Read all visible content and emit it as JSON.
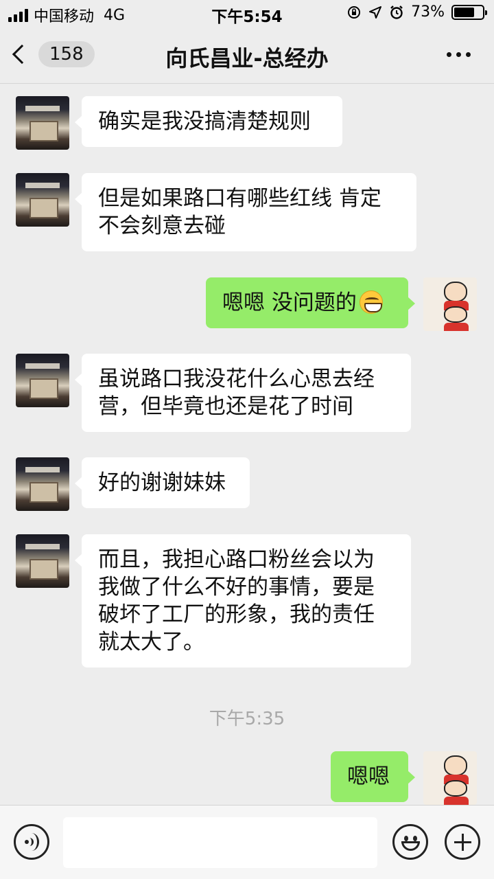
{
  "status_bar": {
    "carrier": "中国移动",
    "network": "4G",
    "time": "下午5:54",
    "battery_percent": "73%",
    "battery_level": 0.73,
    "icons": [
      "orientation-lock-icon",
      "location-arrow-icon",
      "alarm-icon",
      "battery-icon"
    ]
  },
  "nav": {
    "unread_count": "158",
    "title": "向氏昌业-总经办"
  },
  "messages": [
    {
      "side": "in",
      "text": "确实是我没搞清楚规则"
    },
    {
      "side": "in",
      "text": "但是如果路口有哪些红线 肯定不会刻意去碰"
    },
    {
      "side": "out",
      "text": "嗯嗯 没问题的",
      "emoji": "grinning-face-emoji"
    },
    {
      "side": "in",
      "text": "虽说路口我没花什么心思去经营，但毕竟也还是花了时间"
    },
    {
      "side": "in",
      "text": "好的谢谢妹妹"
    },
    {
      "side": "in",
      "text": "而且，我担心路口粉丝会以为我做了什么不好的事情，要是破坏了工厂的形象，我的责任就太大了。"
    },
    {
      "side": "out",
      "text": "嗯嗯"
    }
  ],
  "time_divider": "下午5:35",
  "input_bar": {
    "placeholder": ""
  },
  "colors": {
    "background": "#ededed",
    "outgoing_bubble": "#95ec69",
    "incoming_bubble": "#ffffff"
  }
}
